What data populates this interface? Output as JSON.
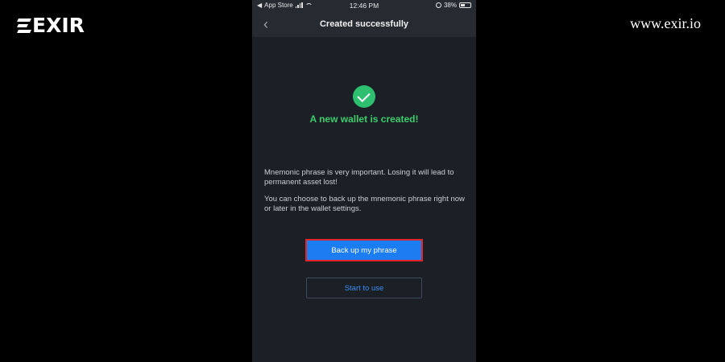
{
  "brand": {
    "logo_text": "EXIR",
    "url": "www.exir.io"
  },
  "status_bar": {
    "carrier": "App Store",
    "time": "12:46 PM",
    "battery": "38%"
  },
  "header": {
    "back_icon": "chevron-left-icon",
    "title": "Created successfully"
  },
  "success": {
    "icon": "check-circle-icon",
    "icon_color": "#2fbf71",
    "message": "A new wallet is created!"
  },
  "info": {
    "paragraph1": "Mnemonic phrase is very important. Losing it will lead to permanent asset lost!",
    "paragraph2": "You can choose to back up the mnemonic phrase right now or later in the wallet settings."
  },
  "actions": {
    "backup_label": "Back up my phrase",
    "start_label": "Start to use"
  },
  "colors": {
    "primary": "#1c7cf2",
    "highlight_border": "#e0262b",
    "success_text": "#3ccd6a"
  }
}
